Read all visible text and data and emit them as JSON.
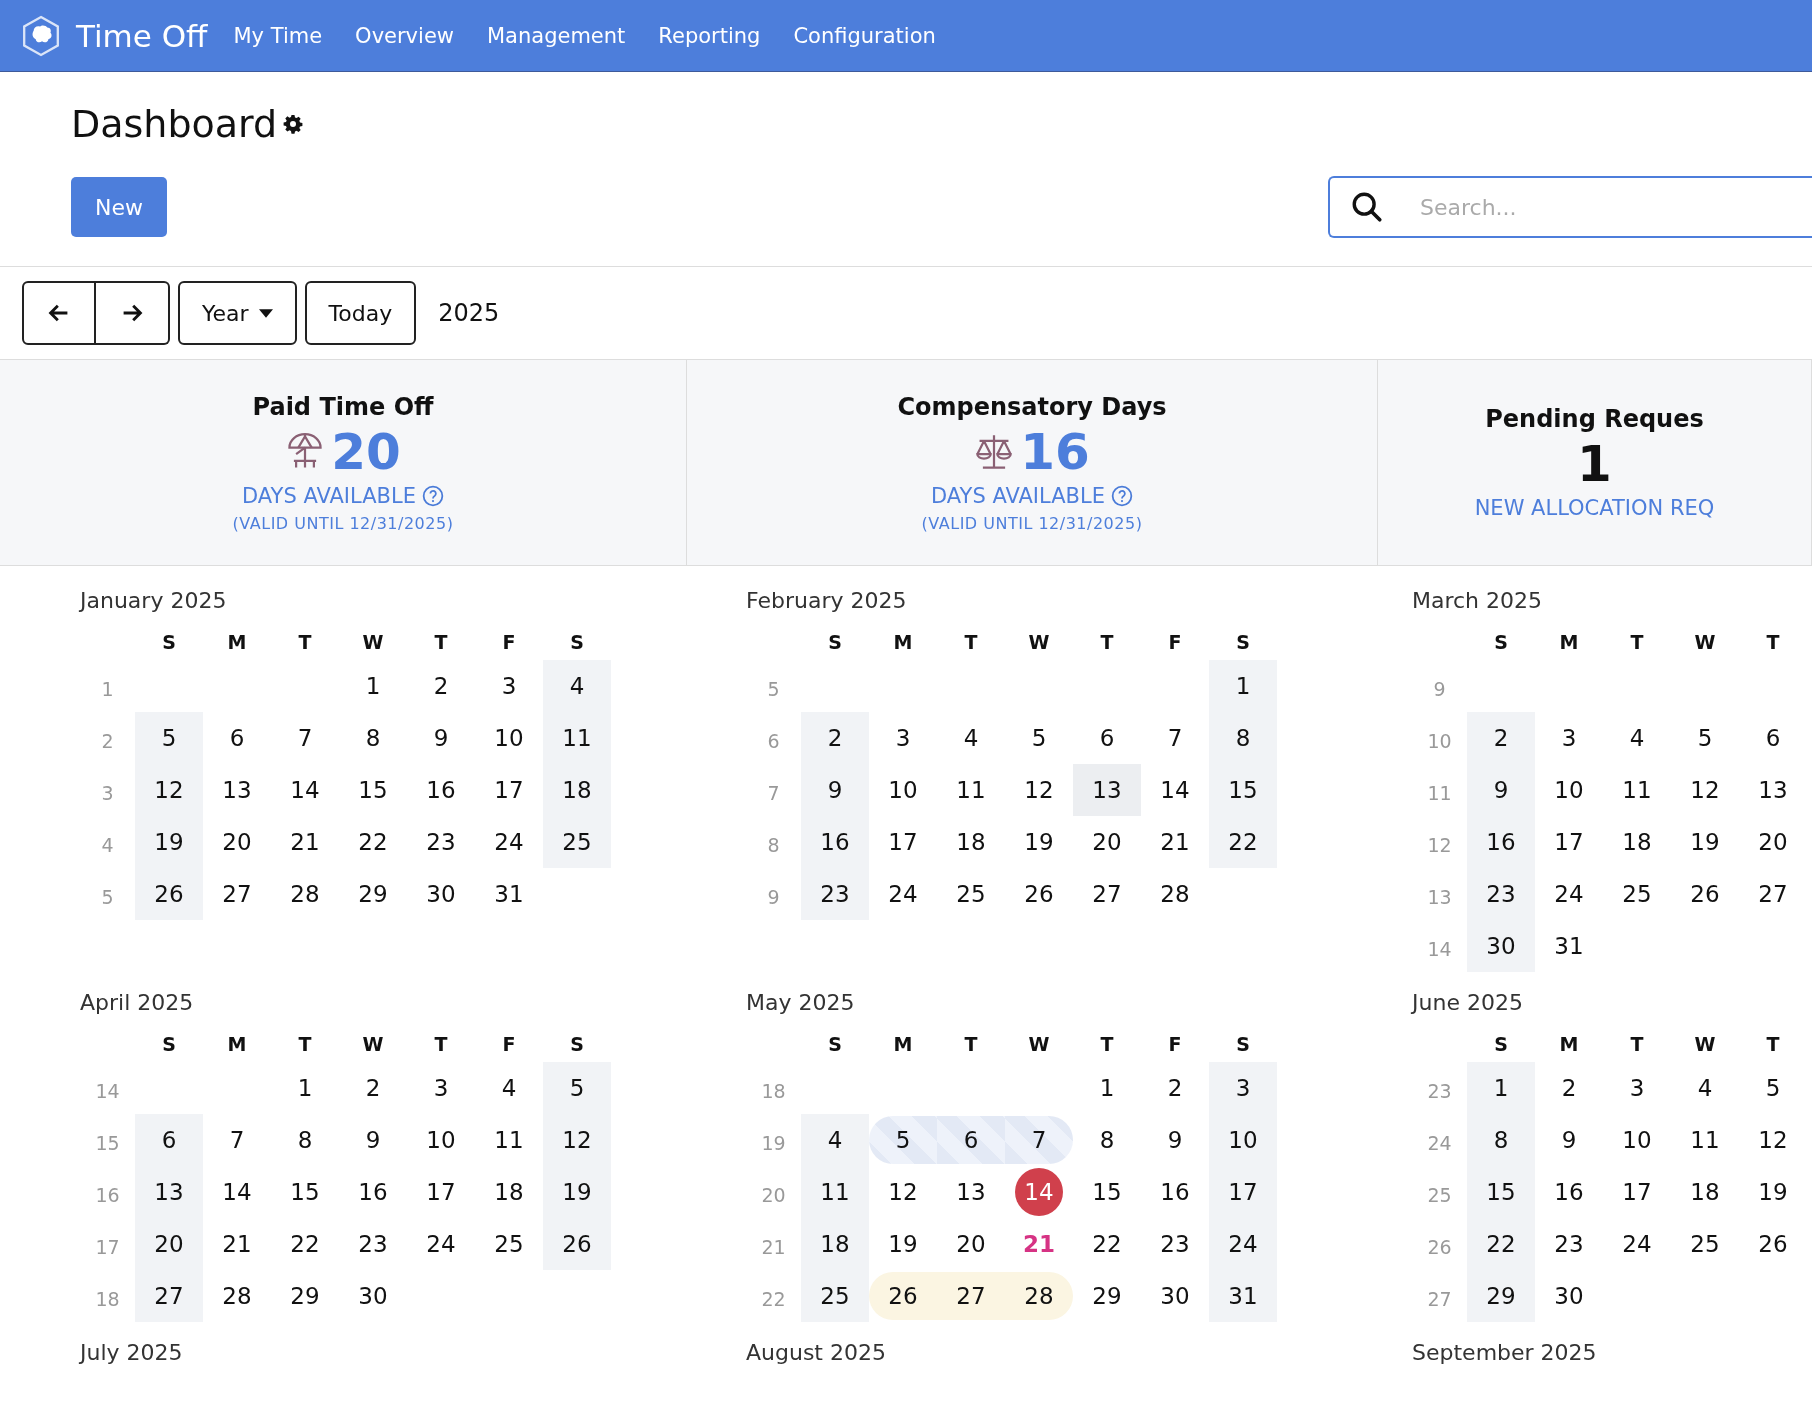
{
  "app": {
    "title": "Time Off"
  },
  "nav": [
    {
      "label": "My Time"
    },
    {
      "label": "Overview"
    },
    {
      "label": "Management"
    },
    {
      "label": "Reporting"
    },
    {
      "label": "Configuration"
    }
  ],
  "page": {
    "title": "Dashboard",
    "new_button": "New",
    "search": {
      "placeholder": "Search..."
    }
  },
  "toolbar": {
    "range": "Year",
    "today": "Today",
    "period": "2025"
  },
  "cards": [
    {
      "kind": "balance",
      "title": "Paid Time Off",
      "value": "20",
      "caption": "DAYS AVAILABLE",
      "note": "(VALID UNTIL 12/31/2025)"
    },
    {
      "kind": "balance",
      "title": "Compensatory Days",
      "value": "16",
      "caption": "DAYS AVAILABLE",
      "note": "(VALID UNTIL 12/31/2025)"
    },
    {
      "kind": "count",
      "title": "Pending Reques",
      "value": "1",
      "caption": "NEW ALLOCATION REQ"
    }
  ],
  "calendar": {
    "months": [
      {
        "title": "January 2025",
        "weekdays": [
          "S",
          "M",
          "T",
          "W",
          "T",
          "F",
          "S"
        ],
        "weeks": [
          {
            "number": "1",
            "days": [
              "1",
              "2",
              "3",
              "4"
            ]
          },
          {
            "number": "2",
            "days": [
              "5",
              "6",
              "7",
              "8",
              "9",
              "10",
              "11"
            ]
          },
          {
            "number": "3",
            "days": [
              "12",
              "13",
              "14",
              "15",
              "16",
              "17",
              "18"
            ]
          },
          {
            "number": "4",
            "days": [
              "19",
              "20",
              "21",
              "22",
              "23",
              "24",
              "25"
            ]
          },
          {
            "number": "5",
            "days": [
              "26",
              "27",
              "28",
              "29",
              "30",
              "31"
            ]
          }
        ]
      },
      {
        "title": "February 2025",
        "weekdays": [
          "S",
          "M",
          "T",
          "W",
          "T",
          "F",
          "S"
        ],
        "weeks": [
          {
            "number": "5",
            "days": [
              "1"
            ]
          },
          {
            "number": "6",
            "days": [
              "2",
              "3",
              "4",
              "5",
              "6",
              "7",
              "8"
            ]
          },
          {
            "number": "7",
            "days": [
              "9",
              "10",
              "11",
              "12",
              {
                "text": "13",
                "kind": "highlighted"
              },
              "14",
              "15"
            ]
          },
          {
            "number": "8",
            "days": [
              "16",
              "17",
              "18",
              "19",
              "20",
              "21",
              "22"
            ]
          },
          {
            "number": "9",
            "days": [
              "23",
              "24",
              "25",
              "26",
              "27",
              "28"
            ]
          }
        ]
      },
      {
        "title": "March 2025",
        "weekdays": [
          "S",
          "M",
          "T",
          "W",
          "T"
        ],
        "weeks": [
          {
            "number": "9"
          },
          {
            "number": "10",
            "days": [
              "2",
              "3",
              "4",
              "5",
              "6"
            ]
          },
          {
            "number": "11",
            "days": [
              "9",
              "10",
              "11",
              "12",
              "13"
            ]
          },
          {
            "number": "12",
            "days": [
              "16",
              "17",
              "18",
              "19",
              "20"
            ]
          },
          {
            "number": "13",
            "days": [
              "23",
              "24",
              "25",
              "26",
              "27"
            ]
          },
          {
            "number": "14",
            "days": [
              "30",
              "31"
            ]
          }
        ]
      },
      {
        "title": "April 2025",
        "weekdays": [
          "S",
          "M",
          "T",
          "W",
          "T",
          "F",
          "S"
        ],
        "weeks": [
          {
            "number": "14",
            "days": [
              "1",
              "2",
              "3",
              "4",
              "5"
            ]
          },
          {
            "number": "15",
            "days": [
              "6",
              "7",
              "8",
              "9",
              "10",
              "11",
              "12"
            ]
          },
          {
            "number": "16",
            "days": [
              "13",
              "14",
              "15",
              "16",
              "17",
              "18",
              "19"
            ]
          },
          {
            "number": "17",
            "days": [
              "20",
              "21",
              "22",
              "23",
              "24",
              "25",
              "26"
            ]
          },
          {
            "number": "18",
            "days": [
              "27",
              "28",
              "29",
              "30"
            ]
          }
        ]
      },
      {
        "title": "May 2025",
        "weekdays": [
          "S",
          "M",
          "T",
          "W",
          "T",
          "F",
          "S"
        ],
        "weeks": [
          {
            "number": "18",
            "days": [
              "1",
              "2",
              "3"
            ]
          },
          {
            "number": "19",
            "days": [
              "4",
              {
                "text": "5",
                "kind": "pending"
              },
              {
                "text": "6",
                "kind": "pending"
              },
              {
                "text": "7",
                "kind": "pending"
              },
              "8",
              "9",
              "10"
            ]
          },
          {
            "number": "20",
            "days": [
              "11",
              "12",
              "13",
              {
                "text": "14",
                "kind": "today"
              },
              "15",
              "16",
              "17"
            ]
          },
          {
            "number": "21",
            "days": [
              "18",
              "19",
              "20",
              {
                "text": "21",
                "kind": "accent"
              },
              "22",
              "23",
              "24"
            ]
          },
          {
            "number": "22",
            "days": [
              "25",
              {
                "text": "26",
                "kind": "approved"
              },
              {
                "text": "27",
                "kind": "approved"
              },
              {
                "text": "28",
                "kind": "approved"
              },
              "29",
              "30",
              "31"
            ]
          }
        ]
      },
      {
        "title": "June 2025",
        "weekdays": [
          "S",
          "M",
          "T",
          "W",
          "T"
        ],
        "weeks": [
          {
            "number": "23",
            "days": [
              "1",
              "2",
              "3",
              "4",
              "5"
            ]
          },
          {
            "number": "24",
            "days": [
              "8",
              "9",
              "10",
              "11",
              "12"
            ]
          },
          {
            "number": "25",
            "days": [
              "15",
              "16",
              "17",
              "18",
              "19"
            ]
          },
          {
            "number": "26",
            "days": [
              "22",
              "23",
              "24",
              "25",
              "26"
            ]
          },
          {
            "number": "27",
            "days": [
              "29",
              "30"
            ]
          }
        ]
      },
      {
        "title": "July 2025"
      },
      {
        "title": "August 2025"
      },
      {
        "title": "September 2025"
      }
    ]
  }
}
